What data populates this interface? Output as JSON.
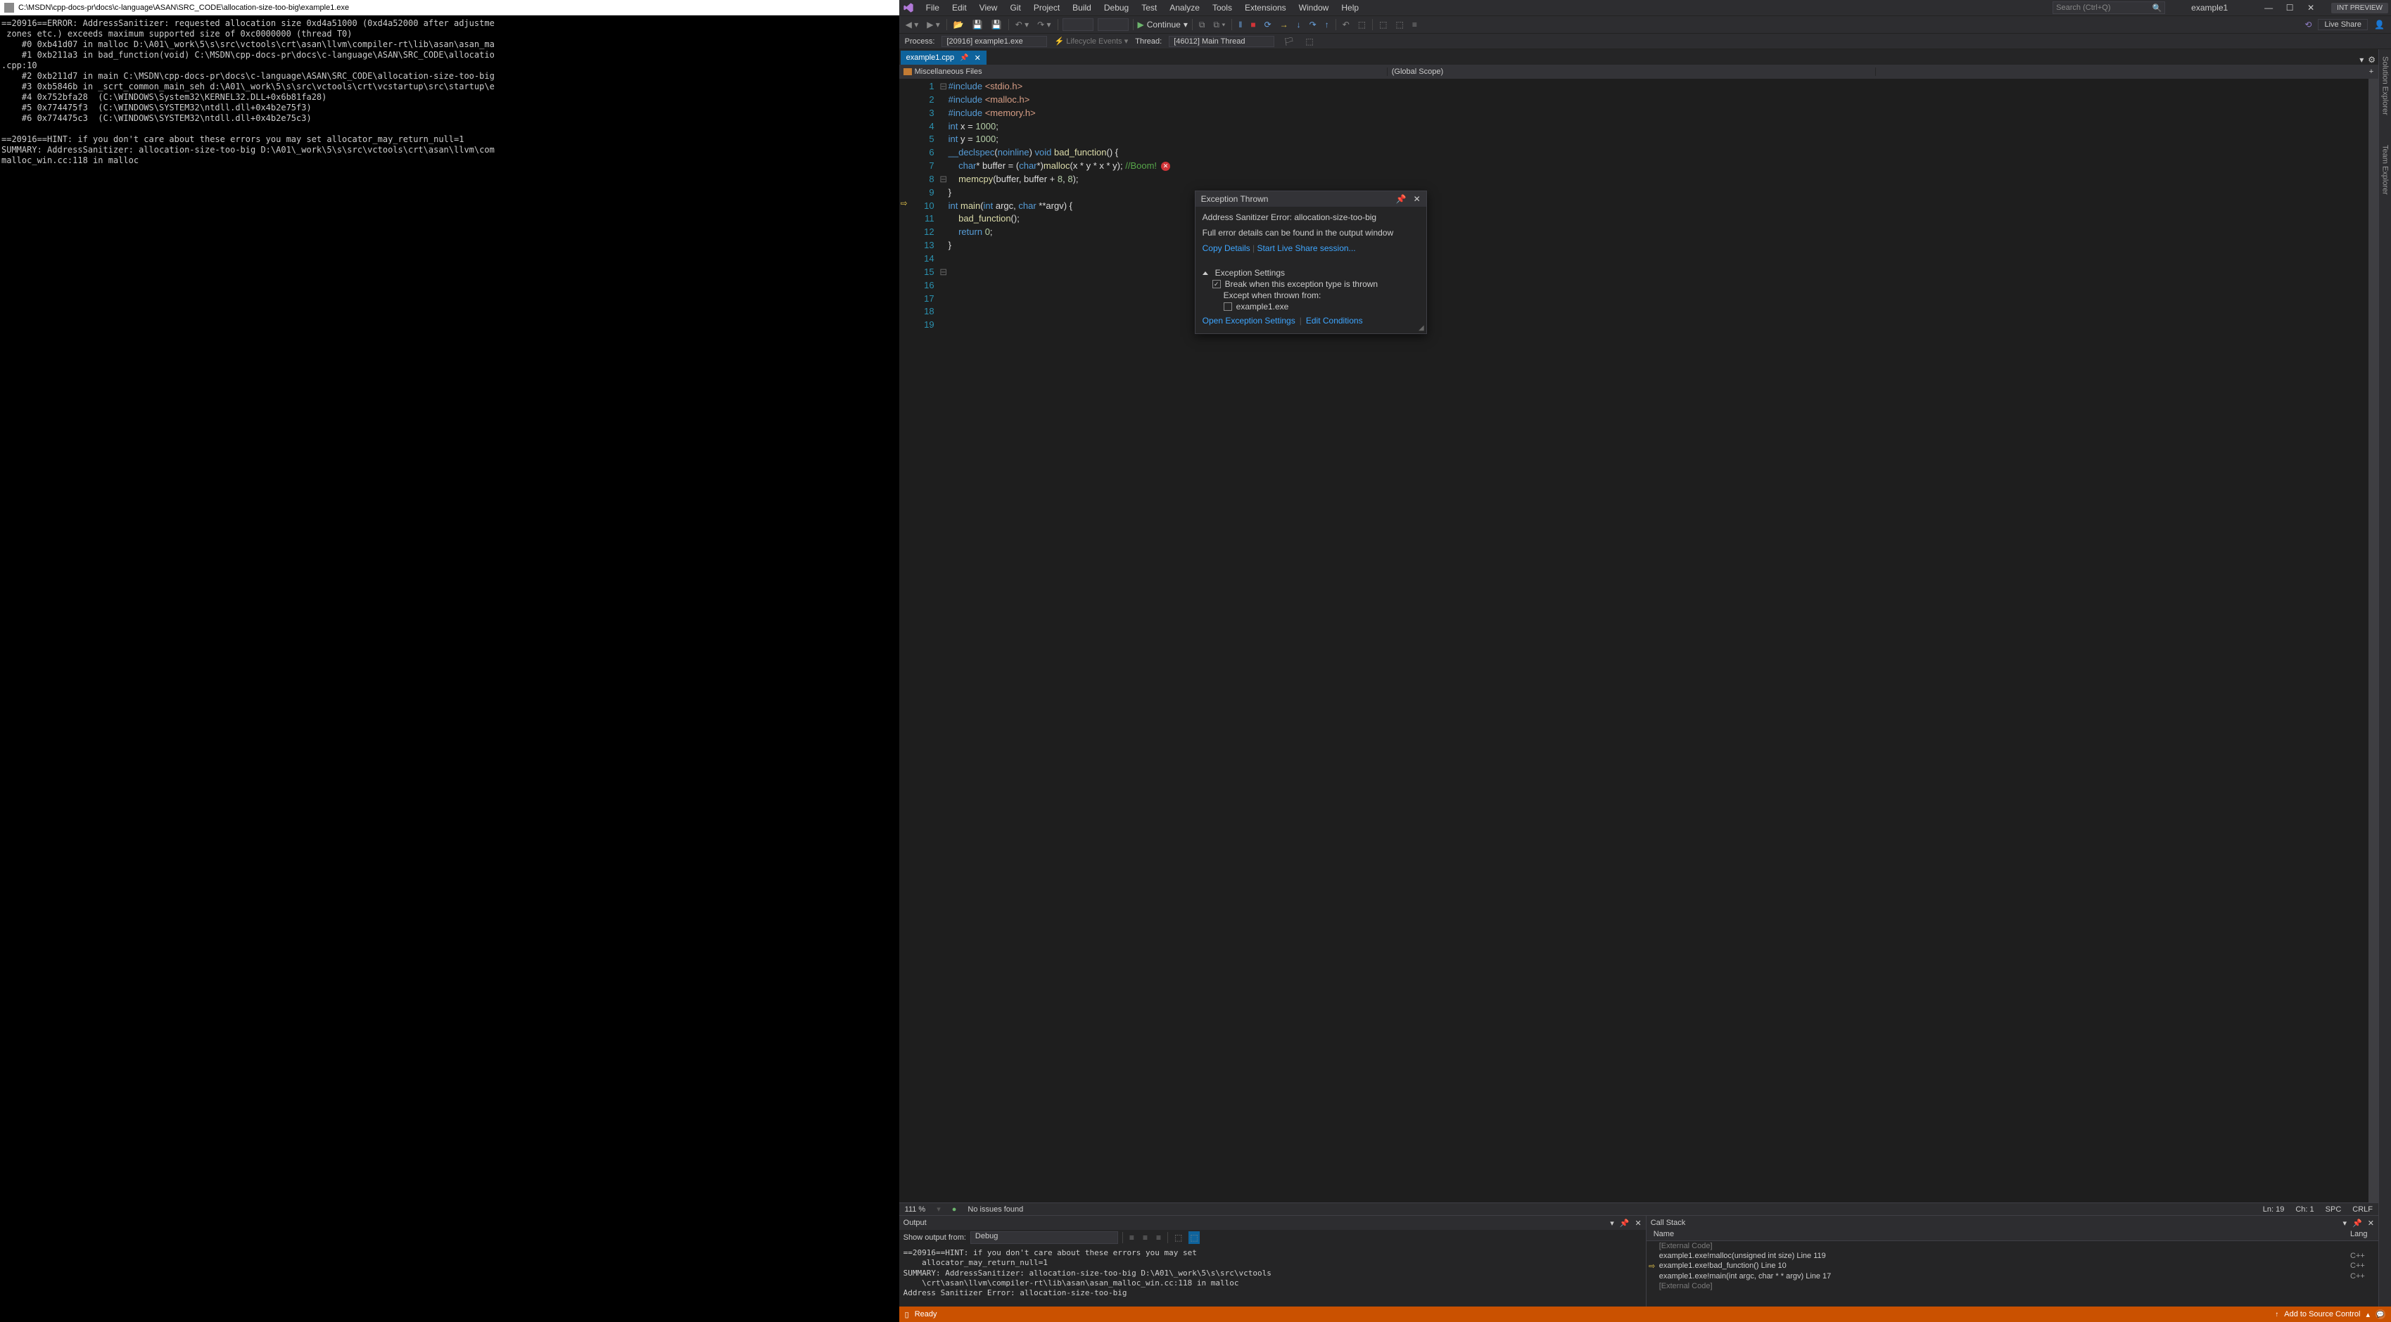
{
  "console": {
    "title": "C:\\MSDN\\cpp-docs-pr\\docs\\c-language\\ASAN\\SRC_CODE\\allocation-size-too-big\\example1.exe",
    "body": "==20916==ERROR: AddressSanitizer: requested allocation size 0xd4a51000 (0xd4a52000 after adjustme\n zones etc.) exceeds maximum supported size of 0xc0000000 (thread T0)\n    #0 0xb41d07 in malloc D:\\A01\\_work\\5\\s\\src\\vctools\\crt\\asan\\llvm\\compiler-rt\\lib\\asan\\asan_ma\n    #1 0xb211a3 in bad_function(void) C:\\MSDN\\cpp-docs-pr\\docs\\c-language\\ASAN\\SRC_CODE\\allocatio\n.cpp:10\n    #2 0xb211d7 in main C:\\MSDN\\cpp-docs-pr\\docs\\c-language\\ASAN\\SRC_CODE\\allocation-size-too-big\n    #3 0xb5846b in _scrt_common_main_seh d:\\A01\\_work\\5\\s\\src\\vctools\\crt\\vcstartup\\src\\startup\\e\n    #4 0x752bfa28  (C:\\WINDOWS\\System32\\KERNEL32.DLL+0x6b81fa28)\n    #5 0x774475f3  (C:\\WINDOWS\\SYSTEM32\\ntdll.dll+0x4b2e75f3)\n    #6 0x774475c3  (C:\\WINDOWS\\SYSTEM32\\ntdll.dll+0x4b2e75c3)\n\n==20916==HINT: if you don't care about these errors you may set allocator_may_return_null=1\nSUMMARY: AddressSanitizer: allocation-size-too-big D:\\A01\\_work\\5\\s\\src\\vctools\\crt\\asan\\llvm\\com\nmalloc_win.cc:118 in malloc"
  },
  "vs": {
    "menu": [
      "File",
      "Edit",
      "View",
      "Git",
      "Project",
      "Build",
      "Debug",
      "Test",
      "Analyze",
      "Tools",
      "Extensions",
      "Window",
      "Help"
    ],
    "search_placeholder": "Search (Ctrl+Q)",
    "solution_name": "example1",
    "preview_badge": "INT PREVIEW",
    "toolbar": {
      "continue": "Continue",
      "liveshare": "Live Share"
    },
    "debugbar": {
      "process_label": "Process:",
      "process_value": "[20916] example1.exe",
      "lifecycle": "Lifecycle Events",
      "thread_label": "Thread:",
      "thread_value": "[46012] Main Thread"
    },
    "tabs": {
      "active": "example1.cpp"
    },
    "navbar": {
      "left": "Miscellaneous Files",
      "mid": "(Global Scope)",
      "right": ""
    },
    "rail": [
      "Solution Explorer",
      "Team Explorer"
    ],
    "editor_status": {
      "zoom": "111 %",
      "issues": "No issues found",
      "ln": "Ln: 19",
      "ch": "Ch: 1",
      "spc": "SPC",
      "enc": "CRLF"
    },
    "exception": {
      "title": "Exception Thrown",
      "msg": "Address Sanitizer Error: allocation-size-too-big",
      "detail": "Full error details can be found in the output window",
      "copy": "Copy Details",
      "liveshare": "Start Live Share session...",
      "settings_header": "Exception Settings",
      "break_when": "Break when this exception type is thrown",
      "except_when": "Except when thrown from:",
      "except_item": "example1.exe",
      "open_settings": "Open Exception Settings",
      "edit_cond": "Edit Conditions"
    },
    "output": {
      "title": "Output",
      "show_label": "Show output from:",
      "show_value": "Debug",
      "body": "==20916==HINT: if you don't care about these errors you may set\n    allocator_may_return_null=1\nSUMMARY: AddressSanitizer: allocation-size-too-big D:\\A01\\_work\\5\\s\\src\\vctools\n    \\crt\\asan\\llvm\\compiler-rt\\lib\\asan\\asan_malloc_win.cc:118 in malloc\nAddress Sanitizer Error: allocation-size-too-big"
    },
    "callstack": {
      "title": "Call Stack",
      "col_name": "Name",
      "col_lang": "Lang",
      "rows": [
        {
          "icon": "",
          "name": "[External Code]",
          "lang": "",
          "dim": true
        },
        {
          "icon": "",
          "name": "example1.exe!malloc(unsigned int size) Line 119",
          "lang": "C++",
          "dim": false
        },
        {
          "icon": "⇨",
          "name": "example1.exe!bad_function() Line 10",
          "lang": "C++",
          "dim": false
        },
        {
          "icon": "",
          "name": "example1.exe!main(int argc, char * * argv) Line 17",
          "lang": "C++",
          "dim": false
        },
        {
          "icon": "",
          "name": "[External Code]",
          "lang": "",
          "dim": true
        }
      ]
    },
    "statusbar": {
      "ready": "Ready",
      "source_control": "Add to Source Control"
    },
    "code": {
      "lines": [
        {
          "n": 1,
          "fold": "⊟",
          "html": "<span class='kw'>#include</span> <span class='str'>&lt;stdio.h&gt;</span>"
        },
        {
          "n": 2,
          "fold": "",
          "html": "<span class='kw'>#include</span> <span class='str'>&lt;malloc.h&gt;</span>"
        },
        {
          "n": 3,
          "fold": "",
          "html": "<span class='kw'>#include</span> <span class='str'>&lt;memory.h&gt;</span>"
        },
        {
          "n": 4,
          "fold": "",
          "html": ""
        },
        {
          "n": 5,
          "fold": "",
          "html": "<span class='kw'>int</span> x = <span class='num'>1000</span>;"
        },
        {
          "n": 6,
          "fold": "",
          "html": "<span class='kw'>int</span> y = <span class='num'>1000</span>;"
        },
        {
          "n": 7,
          "fold": "",
          "html": ""
        },
        {
          "n": 8,
          "fold": "⊟",
          "html": "<span class='kw'>__declspec</span>(<span class='kw'>noinline</span>) <span class='kw'>void</span> <span class='fn'>bad_function</span>() {"
        },
        {
          "n": 9,
          "fold": "",
          "html": ""
        },
        {
          "n": 10,
          "fold": "",
          "html": "    <span class='kw'>char</span>* buffer = (<span class='kw'>char</span>*)<span class='fn'>malloc</span>(x * y * x * y); <span class='cmt'>//Boom!</span>",
          "err": true,
          "arrow": true
        },
        {
          "n": 11,
          "fold": "",
          "html": ""
        },
        {
          "n": 12,
          "fold": "",
          "html": "    <span class='fn'>memcpy</span>(buffer, buffer + <span class='num'>8</span>, <span class='num'>8</span>);"
        },
        {
          "n": 13,
          "fold": "",
          "html": "}"
        },
        {
          "n": 14,
          "fold": "",
          "html": ""
        },
        {
          "n": 15,
          "fold": "⊟",
          "html": "<span class='kw'>int</span> <span class='fn'>main</span>(<span class='kw'>int</span> argc, <span class='kw'>char</span> **argv) {"
        },
        {
          "n": 16,
          "fold": "",
          "html": "    <span class='fn'>bad_function</span>();"
        },
        {
          "n": 17,
          "fold": "",
          "html": "    <span class='kw'>return</span> <span class='num'>0</span>;"
        },
        {
          "n": 18,
          "fold": "",
          "html": "}"
        },
        {
          "n": 19,
          "fold": "",
          "html": ""
        }
      ]
    }
  }
}
